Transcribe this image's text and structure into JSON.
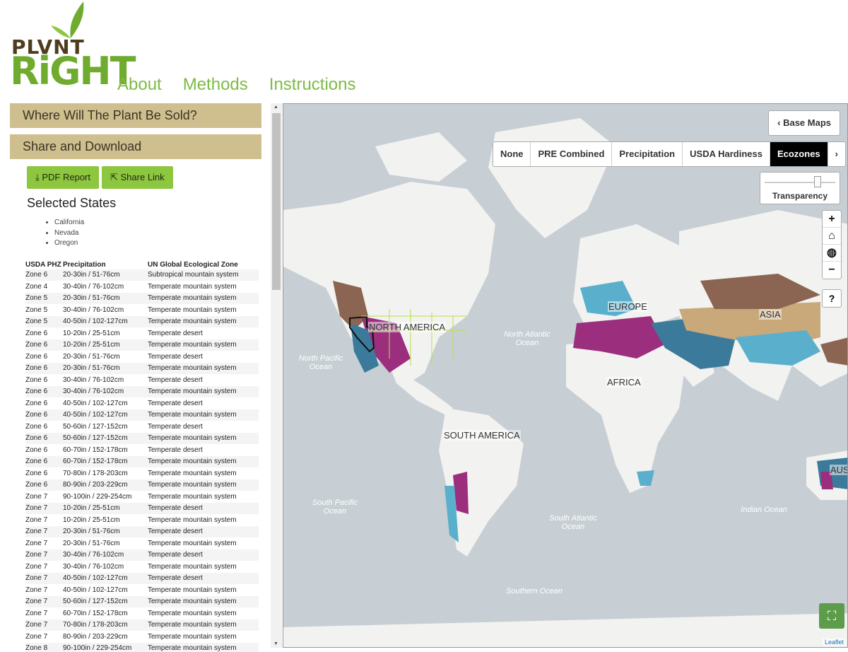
{
  "brand": {
    "top": "PLVNT",
    "bottom": "RiGHT"
  },
  "nav": {
    "about": "About",
    "methods": "Methods",
    "instructions": "Instructions"
  },
  "sidebar": {
    "accordion1": "Where Will The Plant Be Sold?",
    "accordion2": "Share and Download",
    "pdf_button": "PDF Report",
    "share_button": "Share Link",
    "selected_title": "Selected States",
    "states": [
      "California",
      "Nevada",
      "Oregon"
    ],
    "table_headers": [
      "USDA PHZ",
      "Precipitation",
      "UN Global Ecological Zone"
    ],
    "rows": [
      [
        "Zone 6",
        "20-30in / 51-76cm",
        "Subtropical mountain system"
      ],
      [
        "Zone 4",
        "30-40in / 76-102cm",
        "Temperate mountain system"
      ],
      [
        "Zone 5",
        "20-30in / 51-76cm",
        "Temperate mountain system"
      ],
      [
        "Zone 5",
        "30-40in / 76-102cm",
        "Temperate mountain system"
      ],
      [
        "Zone 5",
        "40-50in / 102-127cm",
        "Temperate mountain system"
      ],
      [
        "Zone 6",
        "10-20in / 25-51cm",
        "Temperate desert"
      ],
      [
        "Zone 6",
        "10-20in / 25-51cm",
        "Temperate mountain system"
      ],
      [
        "Zone 6",
        "20-30in / 51-76cm",
        "Temperate desert"
      ],
      [
        "Zone 6",
        "20-30in / 51-76cm",
        "Temperate mountain system"
      ],
      [
        "Zone 6",
        "30-40in / 76-102cm",
        "Temperate desert"
      ],
      [
        "Zone 6",
        "30-40in / 76-102cm",
        "Temperate mountain system"
      ],
      [
        "Zone 6",
        "40-50in / 102-127cm",
        "Temperate desert"
      ],
      [
        "Zone 6",
        "40-50in / 102-127cm",
        "Temperate mountain system"
      ],
      [
        "Zone 6",
        "50-60in / 127-152cm",
        "Temperate desert"
      ],
      [
        "Zone 6",
        "50-60in / 127-152cm",
        "Temperate mountain system"
      ],
      [
        "Zone 6",
        "60-70in / 152-178cm",
        "Temperate desert"
      ],
      [
        "Zone 6",
        "60-70in / 152-178cm",
        "Temperate mountain system"
      ],
      [
        "Zone 6",
        "70-80in / 178-203cm",
        "Temperate mountain system"
      ],
      [
        "Zone 6",
        "80-90in / 203-229cm",
        "Temperate mountain system"
      ],
      [
        "Zone 7",
        "90-100in / 229-254cm",
        "Temperate mountain system"
      ],
      [
        "Zone 7",
        "10-20in / 25-51cm",
        "Temperate desert"
      ],
      [
        "Zone 7",
        "10-20in / 25-51cm",
        "Temperate mountain system"
      ],
      [
        "Zone 7",
        "20-30in / 51-76cm",
        "Temperate desert"
      ],
      [
        "Zone 7",
        "20-30in / 51-76cm",
        "Temperate mountain system"
      ],
      [
        "Zone 7",
        "30-40in / 76-102cm",
        "Temperate desert"
      ],
      [
        "Zone 7",
        "30-40in / 76-102cm",
        "Temperate mountain system"
      ],
      [
        "Zone 7",
        "40-50in / 102-127cm",
        "Temperate desert"
      ],
      [
        "Zone 7",
        "40-50in / 102-127cm",
        "Temperate mountain system"
      ],
      [
        "Zone 7",
        "50-60in / 127-152cm",
        "Temperate mountain system"
      ],
      [
        "Zone 7",
        "60-70in / 152-178cm",
        "Temperate mountain system"
      ],
      [
        "Zone 7",
        "70-80in / 178-203cm",
        "Temperate mountain system"
      ],
      [
        "Zone 7",
        "80-90in / 203-229cm",
        "Temperate mountain system"
      ],
      [
        "Zone 8",
        "90-100in / 229-254cm",
        "Temperate mountain system"
      ]
    ]
  },
  "map": {
    "base_maps": "Base Maps",
    "layers": [
      "None",
      "PRE Combined",
      "Precipitation",
      "USDA Hardiness",
      "Ecozones"
    ],
    "active_layer": "Ecozones",
    "transparency_label": "Transparency",
    "transparency_level": 0.75,
    "labels": {
      "north_america": "NORTH AMERICA",
      "europe": "EUROPE",
      "asia": "ASIA",
      "africa": "AFRICA",
      "south_america": "SOUTH AMERICA",
      "australia": "AUS"
    },
    "oceans": {
      "north_atlantic": "North Atlantic Ocean",
      "north_pacific": "North Pacific Ocean",
      "south_pacific": "South Pacific Ocean",
      "south_atlantic": "South Atlantic Ocean",
      "indian": "Indian Ocean",
      "southern": "Southern Ocean"
    },
    "attribution": "Leaflet",
    "colors": {
      "water": "#c7cfd4",
      "land": "#f2f2f0",
      "desert": "#9b2f7e",
      "mountain": "#3b7a9a",
      "steppe": "#c9a87a",
      "brown": "#8b6552"
    }
  }
}
